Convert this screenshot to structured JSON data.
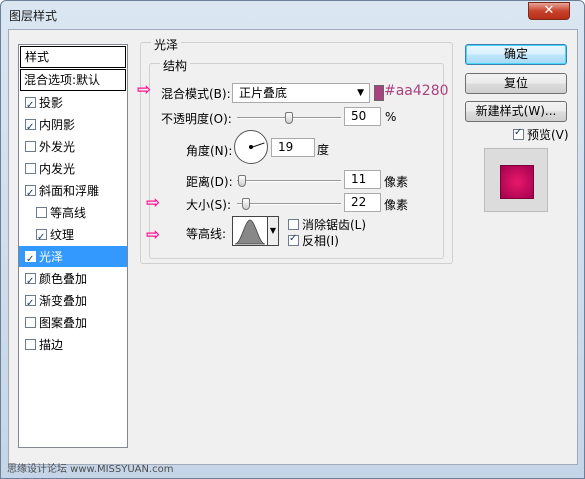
{
  "window": {
    "title": "图层样式",
    "close_glyph": "✕"
  },
  "style_list": {
    "header": "样式",
    "blend_options": "混合选项:默认",
    "items": [
      {
        "label": "投影",
        "checked": true
      },
      {
        "label": "内阴影",
        "checked": true
      },
      {
        "label": "外发光",
        "checked": false
      },
      {
        "label": "内发光",
        "checked": false
      },
      {
        "label": "斜面和浮雕",
        "checked": true
      },
      {
        "label": "等高线",
        "checked": false,
        "sub": true
      },
      {
        "label": "纹理",
        "checked": true,
        "sub": true
      },
      {
        "label": "光泽",
        "checked": true,
        "selected": true
      },
      {
        "label": "颜色叠加",
        "checked": true
      },
      {
        "label": "渐变叠加",
        "checked": true
      },
      {
        "label": "图案叠加",
        "checked": false
      },
      {
        "label": "描边",
        "checked": false
      }
    ]
  },
  "panel": {
    "title": "光泽",
    "group_title": "结构",
    "blend_mode": {
      "label": "混合模式(B):",
      "value": "正片叠底",
      "color_hex_label": "#aa4280",
      "color": "#aa4280"
    },
    "opacity": {
      "label": "不透明度(O):",
      "value": "50",
      "unit": "%",
      "fraction": 0.5
    },
    "angle": {
      "label": "角度(N):",
      "value": "19",
      "unit": "度"
    },
    "distance": {
      "label": "距离(D):",
      "value": "11",
      "unit": "像素",
      "fraction": 0.05
    },
    "size": {
      "label": "大小(S):",
      "value": "22",
      "unit": "像素",
      "fraction": 0.09
    },
    "contour": {
      "label": "等高线:",
      "anti_alias_label": "消除锯齿(L)",
      "anti_alias_checked": false,
      "invert_label": "反相(I)",
      "invert_checked": true
    },
    "arrow_glyph": "⇨"
  },
  "buttons": {
    "ok": "确定",
    "reset": "复位",
    "new_style": "新建样式(W)...",
    "preview_label": "预览(V)",
    "preview_checked": true
  },
  "watermark": "思缘设计论坛 www.MISSYUAN.com",
  "colors": {
    "accent": "#aa4280",
    "selection": "#3399ff",
    "arrow": "#ff1493"
  }
}
